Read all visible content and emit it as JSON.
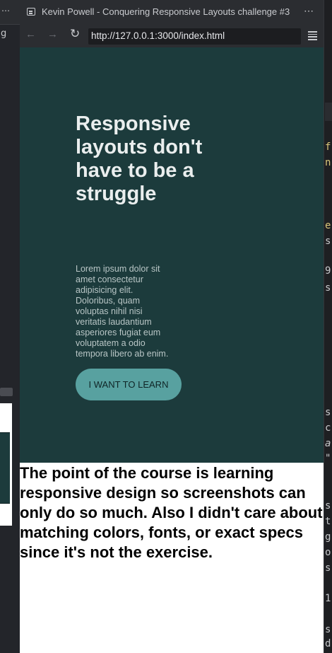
{
  "background_window": {
    "left_menu_glyph": "⋯",
    "left_partial_text": "g",
    "right_partial_chars": [
      "f",
      "n",
      "e",
      "s",
      "9",
      "s",
      "s",
      "c",
      "a",
      "\"",
      "s",
      "t",
      "g",
      "o",
      "s",
      "1",
      "s",
      "d"
    ]
  },
  "browser": {
    "title": "Kevin Powell - Conquering Responsive Layouts challenge #3",
    "more_glyph": "⋯",
    "nav": {
      "back_glyph": "←",
      "forward_glyph": "→",
      "reload_glyph": "↻"
    },
    "url": "http://127.0.0.1:3000/index.html"
  },
  "page": {
    "hero": {
      "title": "Responsive layouts don't have to be a struggle",
      "body": "Lorem ipsum dolor sit amet consectetur adipisicing elit. Doloribus, quam voluptas nihil nisi veritatis laudantium asperiores fugiat eum voluptatem a odio tempora libero ab enim.",
      "cta_label": "I WANT TO LEARN"
    },
    "note": "The point of the course is learning responsive design so screenshots can only do so much. Also I didn't care about matching colors, fonts, or exact specs since it's not the exercise."
  },
  "colors": {
    "hero_bg": "#1c3b3c",
    "hero_title": "#eaeeee",
    "hero_body": "#b9c6c6",
    "cta_bg": "#58a1a0",
    "chrome_bg": "#2b2d31"
  },
  "icons": [
    "tab-icon",
    "more-icon",
    "back-arrow-icon",
    "forward-arrow-icon",
    "reload-icon",
    "menu-icon"
  ]
}
